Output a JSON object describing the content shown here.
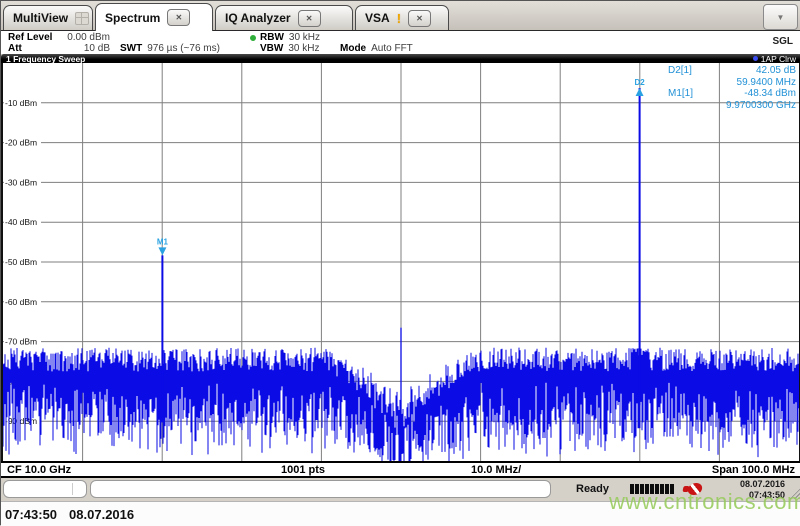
{
  "tabs": {
    "items": [
      {
        "label": "MultiView"
      },
      {
        "label": "Spectrum"
      },
      {
        "label": "IQ Analyzer"
      },
      {
        "label": "VSA"
      }
    ],
    "close_glyph": "✕",
    "warning_glyph": "!",
    "overflow_glyph": "▼"
  },
  "settings": {
    "ref_level_label": "Ref Level",
    "ref_level_value": "0.00 dBm",
    "att_label": "Att",
    "att_value": "10 dB",
    "swt_label": "SWT",
    "swt_value": "976 µs (~76 ms)",
    "rbw_label": "RBW",
    "rbw_value": "30 kHz",
    "vbw_label": "VBW",
    "vbw_value": "30 kHz",
    "mode_label": "Mode",
    "mode_value": "Auto FFT",
    "single_sweep_label": "SGL"
  },
  "window": {
    "title": "1 Frequency Sweep",
    "trace_label": "1AP Clrw"
  },
  "marker_info": {
    "rows": [
      {
        "label": "D2[1]",
        "value": "42.05 dB"
      },
      {
        "label": "",
        "value": "59.9400 MHz"
      },
      {
        "label": "M1[1]",
        "value": "-48.34 dBm"
      },
      {
        "label": "",
        "value": "9.9700300 GHz"
      }
    ]
  },
  "axis": {
    "y_labels": [
      "-10 dBm",
      "-20 dBm",
      "-30 dBm",
      "-40 dBm",
      "-50 dBm",
      "-60 dBm",
      "-70 dBm",
      "-80 dBm",
      "-90 dBm"
    ],
    "cf": "CF 10.0 GHz",
    "points": "1001 pts",
    "per_div": "10.0 MHz/",
    "span": "Span 100.0 MHz"
  },
  "chart_data": {
    "type": "spectrum-trace",
    "title": "1 Frequency Sweep",
    "y_unit": "dBm",
    "ref_level_dbm": 0,
    "db_per_div": 10,
    "y_range": [
      -100,
      0
    ],
    "center_freq_ghz": 10.0,
    "span_mhz": 100,
    "mhz_per_div": 10,
    "sweep_points": 1001,
    "grid": true,
    "noise": {
      "top_dbm": -71.5,
      "top_jitter_db": 6,
      "depth_db": 8,
      "depth_jitter_db": 14,
      "floor_dbm": -100.5,
      "seed": 20160807
    },
    "notch": {
      "center_mhz": 0,
      "halfwidth_mhz": 9,
      "depth_db": 14
    },
    "peaks": [
      {
        "offset_mhz": -29.97,
        "level_dbm": -48.34,
        "width": 2,
        "base_dbm": -86
      },
      {
        "offset_mhz": 29.97,
        "level_dbm": -6.29,
        "width": 2,
        "base_dbm": -86
      },
      {
        "offset_mhz": 0,
        "level_dbm": -66.5,
        "width": 1.3,
        "base_dbm": -88
      }
    ],
    "markers": [
      {
        "id": "M1",
        "shape": "down",
        "offset_mhz": -29.97,
        "level_dbm": -48.34
      },
      {
        "id": "D2",
        "shape": "up",
        "offset_mhz": 29.97,
        "level_dbm": -6.29
      }
    ],
    "trace_color": "#0b0be6",
    "marker_color": "#2aa2e2",
    "grid_color": "#7f7f7f"
  },
  "status": {
    "ready_label": "Ready",
    "progress_segments": 9,
    "date": "08.07.2016",
    "time": "07:43:50"
  },
  "footer": {
    "time": "07:43:50",
    "date": "08.07.2016"
  },
  "watermark": "www.cntronics.com"
}
